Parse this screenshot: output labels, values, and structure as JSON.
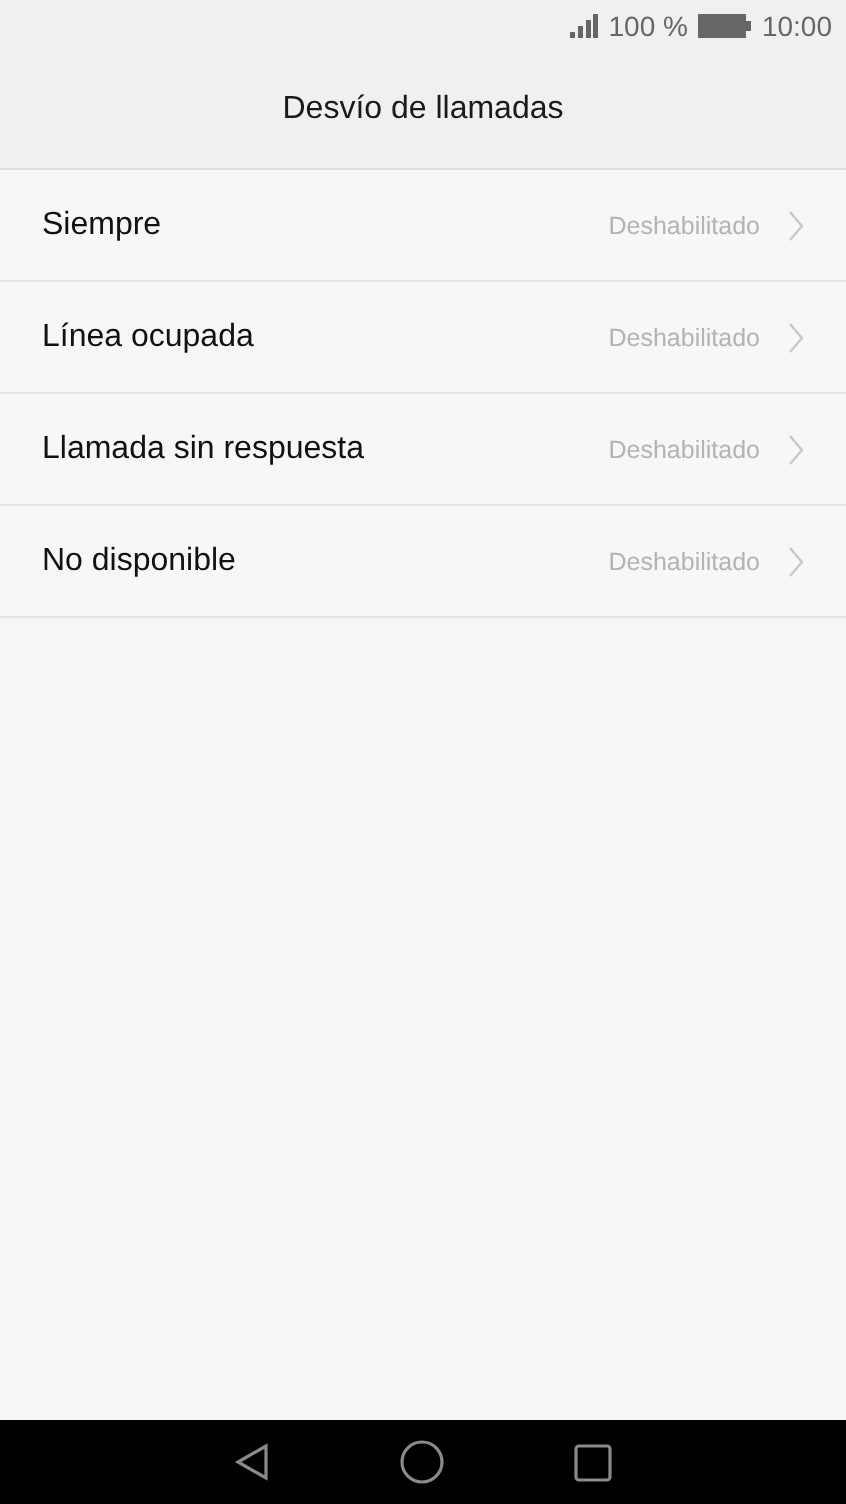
{
  "status_bar": {
    "battery": "100 %",
    "time": "10:00"
  },
  "header": {
    "title": "Desvío de llamadas"
  },
  "items": [
    {
      "label": "Siempre",
      "value": "Deshabilitado"
    },
    {
      "label": "Línea ocupada",
      "value": "Deshabilitado"
    },
    {
      "label": "Llamada sin respuesta",
      "value": "Deshabilitado"
    },
    {
      "label": "No disponible",
      "value": "Deshabilitado"
    }
  ]
}
